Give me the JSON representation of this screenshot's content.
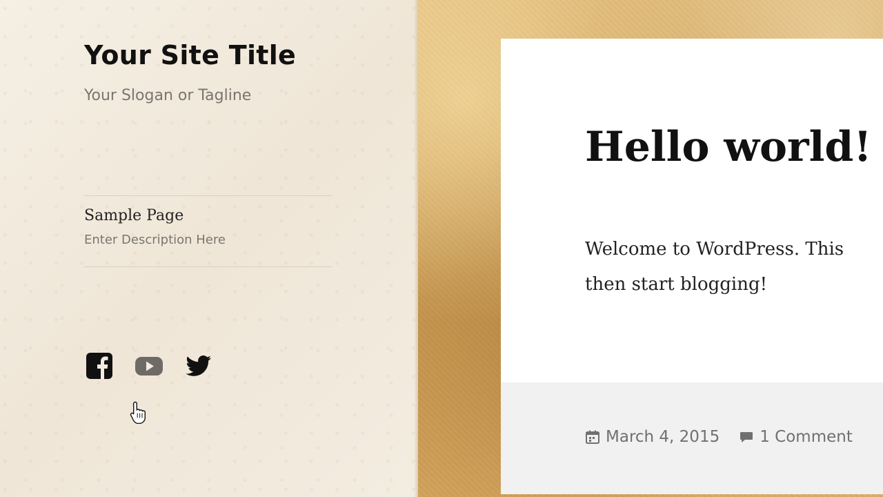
{
  "site": {
    "title": "Your Site Title",
    "tagline": "Your Slogan or Tagline"
  },
  "menu": {
    "items": [
      {
        "label": "Sample Page",
        "description": "Enter Description Here"
      }
    ]
  },
  "social": {
    "links": [
      {
        "icon": "facebook-icon"
      },
      {
        "icon": "youtube-icon"
      },
      {
        "icon": "twitter-icon"
      }
    ]
  },
  "post": {
    "title": "Hello world!",
    "excerpt_line1": "Welcome to WordPress. This",
    "excerpt_line2": "then start blogging!",
    "date": "March 4, 2015",
    "comments": "1 Comment"
  },
  "colors": {
    "title": "#111111",
    "muted": "#7a7570",
    "footer_bg": "#f1f1f1"
  }
}
